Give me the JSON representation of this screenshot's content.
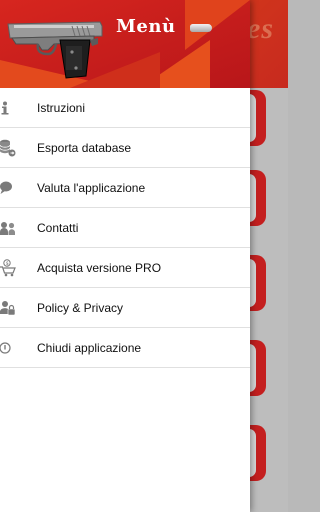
{
  "background": {
    "title_fragment": "es"
  },
  "drawer": {
    "title": "Menù",
    "items": [
      {
        "label": "Istruzioni",
        "icon": "info-icon"
      },
      {
        "label": "Esporta database",
        "icon": "database-export-icon"
      },
      {
        "label": "Valuta l'applicazione",
        "icon": "speech-bubble-icon"
      },
      {
        "label": "Contatti",
        "icon": "contacts-icon"
      },
      {
        "label": "Acquista versione PRO",
        "icon": "shopping-cart-icon"
      },
      {
        "label": "Policy & Privacy",
        "icon": "privacy-lock-icon"
      },
      {
        "label": "Chiudi applicazione",
        "icon": "power-icon"
      }
    ]
  },
  "colors": {
    "header_red": "#c71e1c",
    "header_orange": "#e6501d",
    "accent_red": "#c41f1f"
  }
}
